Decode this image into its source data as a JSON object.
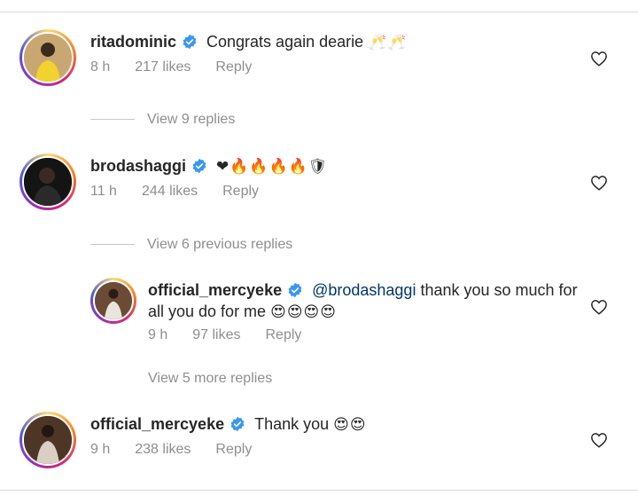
{
  "comments": [
    {
      "username": "ritadominic",
      "text": "Congrats again dearie",
      "emoji": "🥂🥂",
      "time": "8 h",
      "likes": "217 likes",
      "reply": "Reply"
    },
    {
      "username": "brodashaggi",
      "text": "",
      "emoji": "❤🔥🔥🔥🔥🛡",
      "time": "11 h",
      "likes": "244 likes",
      "reply": "Reply"
    },
    {
      "username": "official_mercyeke",
      "mention": "@brodashaggi",
      "text": "thank you so much for",
      "text2": "all you do for me",
      "emoji": "😍😍😍😍",
      "time": "9 h",
      "likes": "97 likes",
      "reply": "Reply"
    },
    {
      "username": "official_mercyeke",
      "text": "Thank you",
      "emoji": "😍😍",
      "time": "9 h",
      "likes": "238 likes",
      "reply": "Reply"
    }
  ],
  "view_replies": [
    "View 9 replies",
    "View 6 previous replies",
    "View 5 more replies"
  ],
  "colors": {
    "verified": "#3897f0",
    "secondary_text": "#8e8e8e",
    "mention": "#00376b"
  }
}
